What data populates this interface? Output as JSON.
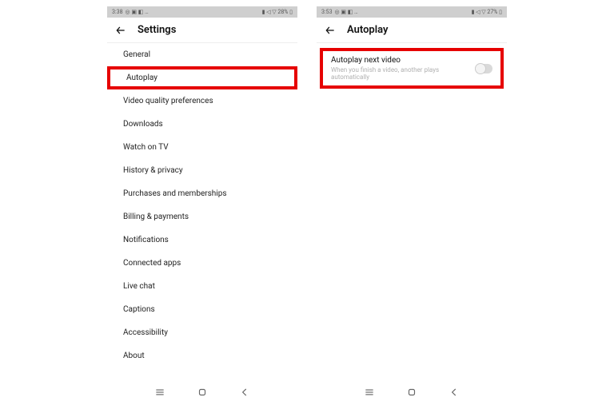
{
  "phone1": {
    "status": {
      "time": "3:38",
      "iconsLeft": "◎ ▣ ◧ …",
      "iconsRight": "▮ ◁ ▽ 28% ▯"
    },
    "header": {
      "title": "Settings"
    },
    "items": [
      {
        "label": "General"
      },
      {
        "label": "Autoplay",
        "highlighted": true
      },
      {
        "label": "Video quality preferences"
      },
      {
        "label": "Downloads"
      },
      {
        "label": "Watch on TV"
      },
      {
        "label": "History & privacy"
      },
      {
        "label": "Purchases and memberships"
      },
      {
        "label": "Billing & payments"
      },
      {
        "label": "Notifications"
      },
      {
        "label": "Connected apps"
      },
      {
        "label": "Live chat"
      },
      {
        "label": "Captions"
      },
      {
        "label": "Accessibility"
      },
      {
        "label": "About"
      }
    ]
  },
  "phone2": {
    "status": {
      "time": "3:53",
      "iconsLeft": "◎ ▣ ◧ …",
      "iconsRight": "▮ ◁ ▽ 27% ▯"
    },
    "header": {
      "title": "Autoplay"
    },
    "autoplay": {
      "title": "Autoplay next video",
      "subtitle": "When you finish a video, another plays automatically",
      "enabled": false
    }
  }
}
